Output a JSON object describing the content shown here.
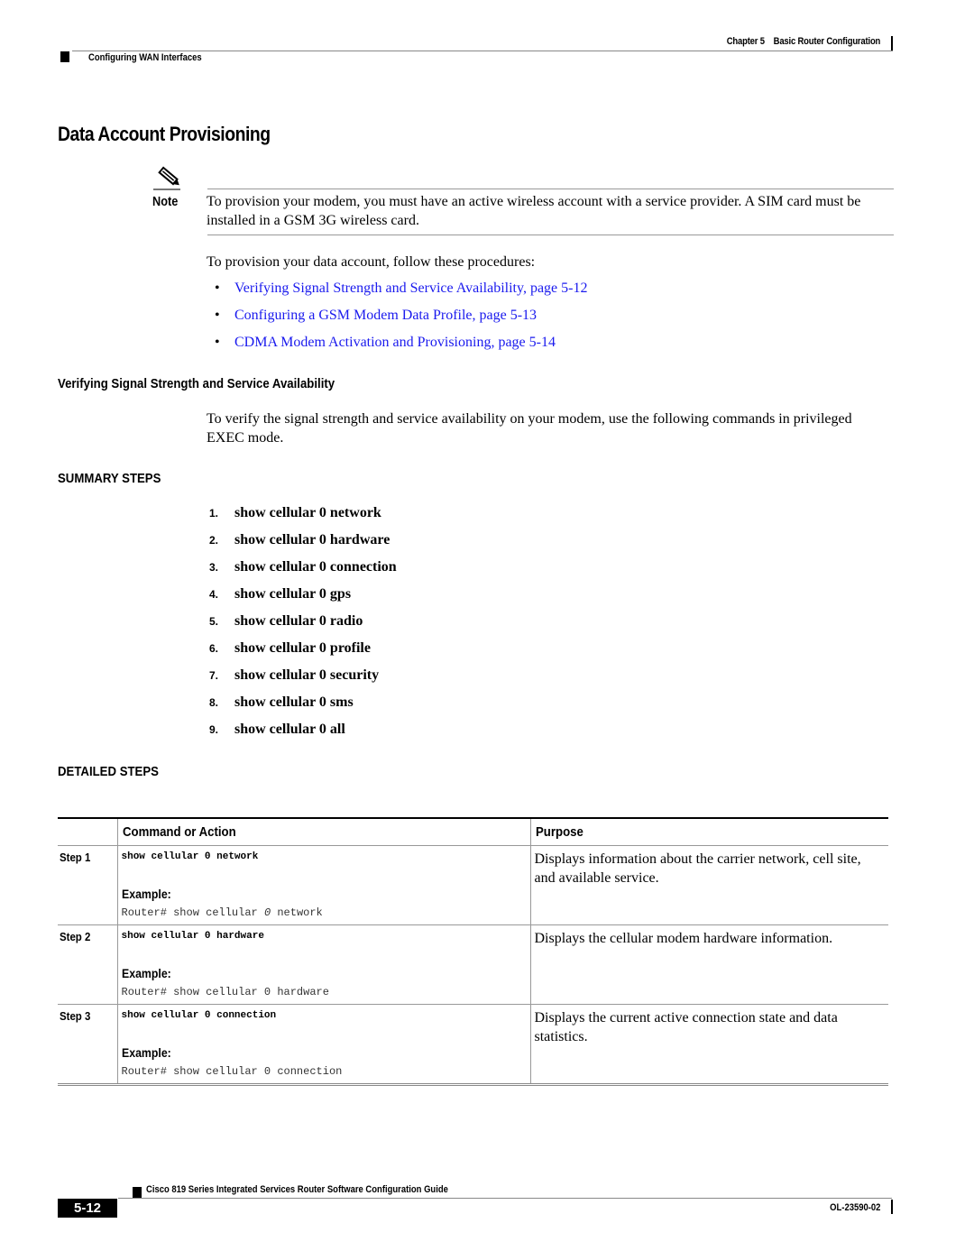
{
  "header": {
    "chapter": "Chapter 5    Basic Router Configuration",
    "section": "Configuring WAN Interfaces"
  },
  "title": "Data Account Provisioning",
  "note": {
    "icon": "pencil-note-icon",
    "label": "Note",
    "text": "To provision your modem, you must have an active wireless account with a service provider. A SIM card must be installed in a GSM 3G wireless card."
  },
  "intro": "To provision your data account, follow these procedures:",
  "procedures": [
    {
      "label": "Verifying Signal Strength and Service Availability, page 5-12"
    },
    {
      "label": "Configuring a GSM Modem Data Profile, page 5-13"
    },
    {
      "label": "CDMA Modem Activation and Provisioning, page 5-14"
    }
  ],
  "subsection": {
    "title": "Verifying Signal Strength and Service Availability",
    "text": "To verify the signal strength and service availability on your modem, use the following commands in privileged EXEC mode."
  },
  "summary_steps": {
    "heading": "SUMMARY STEPS",
    "items": [
      {
        "num": "1.",
        "cmd": "show cellular 0 network"
      },
      {
        "num": "2.",
        "cmd": "show cellular 0 hardware"
      },
      {
        "num": "3.",
        "cmd": "show cellular 0 connection"
      },
      {
        "num": "4.",
        "cmd": "show cellular 0 gps"
      },
      {
        "num": "5.",
        "cmd": "show cellular 0 radio"
      },
      {
        "num": "6.",
        "cmd": "show cellular 0 profile"
      },
      {
        "num": "7.",
        "cmd": "show cellular 0 security"
      },
      {
        "num": "8.",
        "cmd": "show cellular 0 sms"
      },
      {
        "num": "9.",
        "cmd": "show cellular 0 all"
      }
    ]
  },
  "detailed_steps": {
    "heading": "DETAILED STEPS",
    "columns": [
      "",
      "Command or Action",
      "Purpose"
    ],
    "rows": [
      {
        "step": "Step 1",
        "cmd": "show cellular 0 network",
        "example_label": "Example:",
        "example": "Router# show cellular 0 network",
        "purpose": "Displays information about the carrier network, cell site, and available service."
      },
      {
        "step": "Step 2",
        "cmd": "show cellular 0 hardware",
        "example_label": "Example:",
        "example": "Router# show cellular 0 hardware",
        "purpose": "Displays the cellular modem hardware information."
      },
      {
        "step": "Step 3",
        "cmd": "show cellular 0 connection",
        "example_label": "Example:",
        "example": "Router# show cellular 0 connection",
        "purpose": "Displays the current active connection state and data statistics."
      }
    ]
  },
  "footer": {
    "guide_title": "Cisco 819 Series Integrated Services Router Software Configuration Guide",
    "page": "5-12",
    "doc_id": "OL-23590-02"
  },
  "colors": {
    "link": "#1a1aee"
  }
}
